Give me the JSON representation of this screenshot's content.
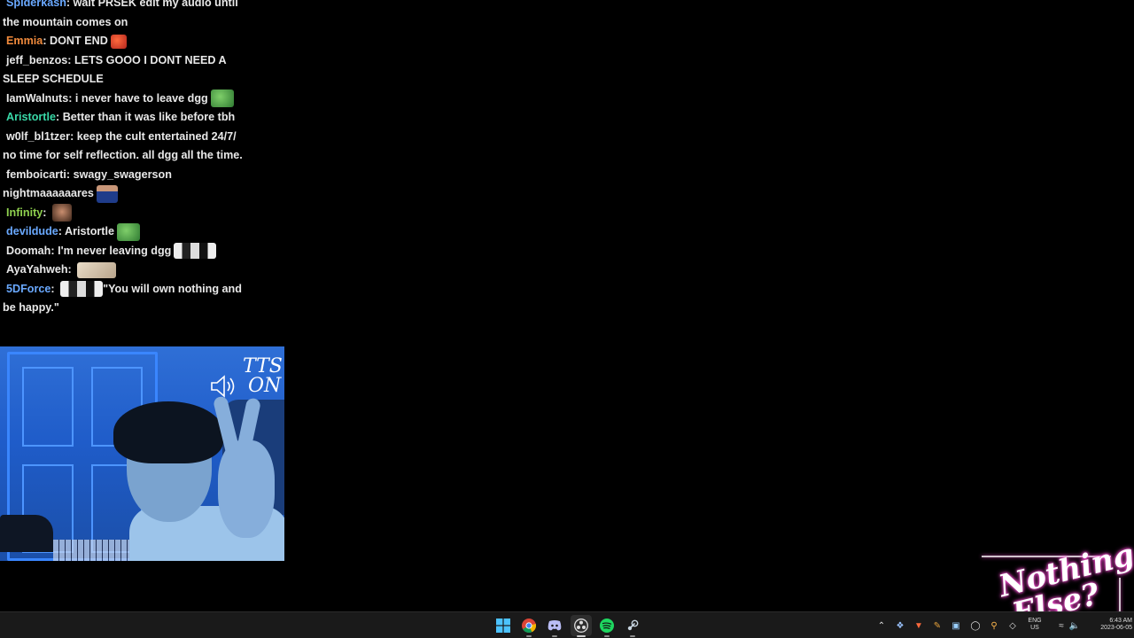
{
  "chat": {
    "messages": [
      {
        "user": "Spiderkash",
        "color": "#6aa9ff",
        "text": "wait PRSEK edit my audio until the mountain comes on"
      },
      {
        "user": "Emmia",
        "color": "#f08a3c",
        "text": "DONT END",
        "emote": "pepe-angry-emote"
      },
      {
        "user": "jeff_benzos",
        "color": "#e8e8e8",
        "text": "LETS GOOO I DONT NEED A SLEEP SCHEDULE"
      },
      {
        "user": "IamWalnuts",
        "color": "#e8e8e8",
        "text": "i never have to leave dgg",
        "emote": "pepe-emote"
      },
      {
        "user": "Aristortle",
        "color": "#39d9a8",
        "text": "Better than it was like before tbh"
      },
      {
        "user": "w0lf_bl1tzer",
        "color": "#e8e8e8",
        "text": "keep the cult entertained 24/7/ no time for self reflection. all dgg all the time."
      },
      {
        "user": "femboicarti",
        "color": "#e8e8e8",
        "text": "swagy_swagerson nightmaaaaaares",
        "emote": "person-emote"
      },
      {
        "user": "Infinity",
        "color": "#8fd14f",
        "text": "",
        "emote": "face-emote"
      },
      {
        "user": "devildude",
        "color": "#6aa9ff",
        "text": "Aristortle",
        "emote": "pepe-emote"
      },
      {
        "user": "Doomah",
        "color": "#e8e8e8",
        "text": "I'm never leaving dgg",
        "emote": "bw-face-emote"
      },
      {
        "user": "AyaYahweh",
        "color": "#e8e8e8",
        "text": "",
        "emote": "beige-emote"
      },
      {
        "user": "5DForce",
        "color": "#6aa9ff",
        "text": "\"You will own nothing and be happy.\"",
        "emote": "bw-face-emote"
      }
    ]
  },
  "webcam": {
    "tts_line1": "TTS",
    "tts_line2": "ON"
  },
  "overlay": {
    "logo_line1": "Nothing",
    "logo_line2": "Else?"
  },
  "taskbar": {
    "apps": [
      {
        "name": "start-button",
        "icon": "windows-icon"
      },
      {
        "name": "chrome-button",
        "icon": "chrome-icon"
      },
      {
        "name": "discord-button",
        "icon": "discord-icon"
      },
      {
        "name": "obs-button",
        "icon": "obs-icon"
      },
      {
        "name": "spotify-button",
        "icon": "spotify-icon"
      },
      {
        "name": "steam-button",
        "icon": "steam-icon"
      }
    ],
    "tray": {
      "lang_line1": "ENG",
      "lang_line2": "US",
      "time": "6:43 AM",
      "date": "2023-06-05"
    }
  }
}
